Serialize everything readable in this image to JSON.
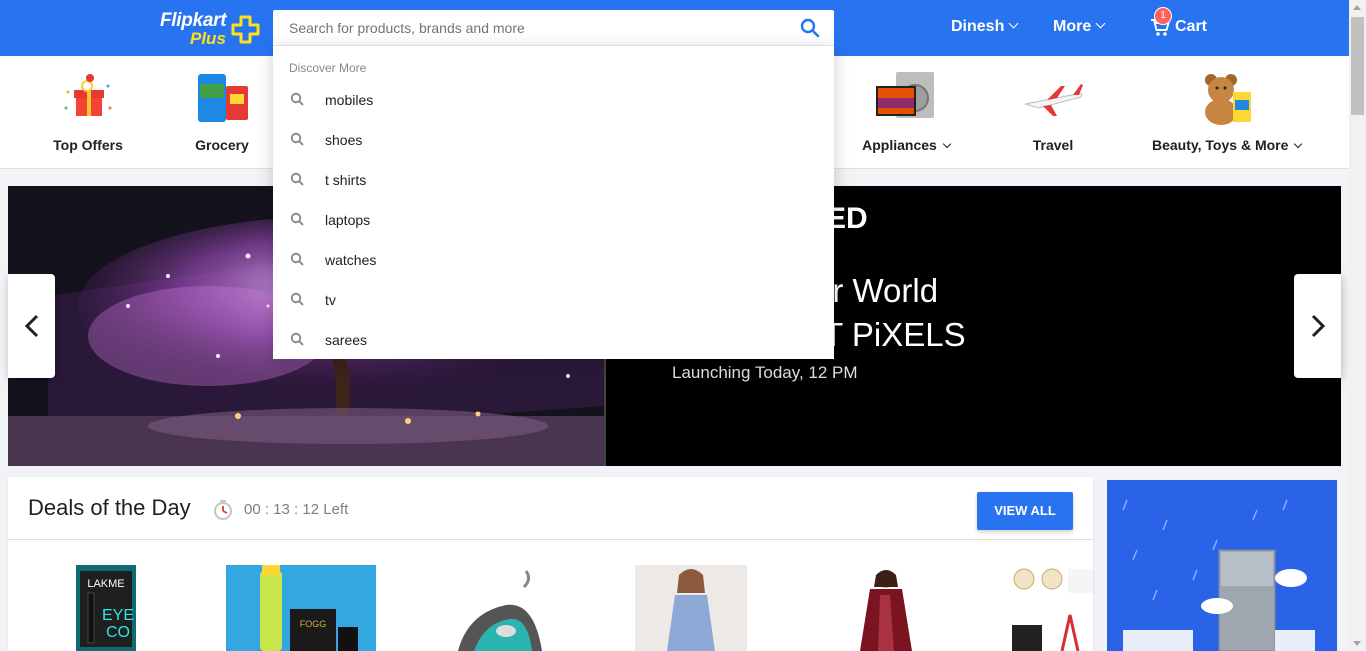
{
  "header": {
    "logo_top": "Flipkart",
    "logo_bottom": "Plus",
    "user_label": "Dinesh",
    "more_label": "More",
    "cart_label": "Cart",
    "cart_count": "1",
    "accent": "#2874f0"
  },
  "search": {
    "placeholder": "Search for products, brands and more",
    "value": "",
    "dropdown_header": "Discover More",
    "suggestions": [
      "mobiles",
      "shoes",
      "t shirts",
      "laptops",
      "watches",
      "tv",
      "sarees"
    ]
  },
  "categories": [
    {
      "label": "Top Offers",
      "icon": "gift-icon"
    },
    {
      "label": "Grocery",
      "icon": "grocery-icon"
    },
    {
      "label": "Appliances",
      "icon": "appliances-icon",
      "has_dropdown": true
    },
    {
      "label": "Travel",
      "icon": "airplane-icon"
    },
    {
      "label": "Beauty, Toys & More",
      "icon": "teddy-icon",
      "has_dropdown": true
    }
  ],
  "banner": {
    "tag": "ED",
    "headline_1": "ur World",
    "headline_2": "IT PiXELS",
    "subline": "Launching Today, 12 PM"
  },
  "deals": {
    "title": "Deals of the Day",
    "timer": "00 : 13 : 12 Left",
    "view_all": "VIEW ALL"
  },
  "products": [
    {
      "name": "lakme-eyeliner",
      "text": "LAKME"
    },
    {
      "name": "fogg-deodorant",
      "text": "FOGG"
    },
    {
      "name": "steam-iron",
      "text": ""
    },
    {
      "name": "dress",
      "text": ""
    },
    {
      "name": "saree",
      "text": ""
    },
    {
      "name": "accessories",
      "text": ""
    }
  ]
}
